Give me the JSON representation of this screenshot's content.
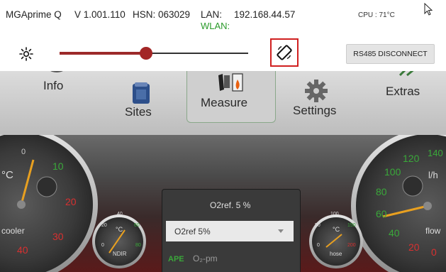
{
  "status": {
    "device": "MGAprime Q",
    "version": "V 1.001.110",
    "serial": "HSN: 063029",
    "lan_label": "LAN:",
    "ip": "192.168.44.57",
    "wlan_label": "WLAN:",
    "cpu": "CPU : 71°C"
  },
  "controls": {
    "brightness_level": 0.46,
    "rs485_label": "RS485 DISCONNECT"
  },
  "nav": {
    "info": "Info",
    "sites": "Sites",
    "measure": "Measure",
    "settings": "Settings",
    "extras": "Extras"
  },
  "left_gauge": {
    "unit": "°C",
    "label": "cooler",
    "ticks": [
      "0",
      "10",
      "20",
      "30",
      "40"
    ]
  },
  "ndir_gauge": {
    "unit": "°C",
    "label": "NDIR",
    "ticks": [
      "40",
      "20",
      "60",
      "0",
      "80"
    ]
  },
  "hose_gauge": {
    "unit": "°C",
    "label": "hose",
    "ticks": [
      "100",
      "50",
      "150",
      "0",
      "200"
    ]
  },
  "right_gauge": {
    "unit": "l/h",
    "label": "flow",
    "ticks": [
      "140",
      "120",
      "100",
      "80",
      "60",
      "40",
      "20",
      "0"
    ]
  },
  "panel": {
    "title": "O2ref. 5 %",
    "dropdown_value": "O2ref  5%",
    "ape": "APE",
    "o2pm": "O₂-pm"
  },
  "colors": {
    "accent_red": "#a32626",
    "highlight_red": "#d02020",
    "green_tick": "#3aa83a",
    "red_tick": "#d83030"
  }
}
